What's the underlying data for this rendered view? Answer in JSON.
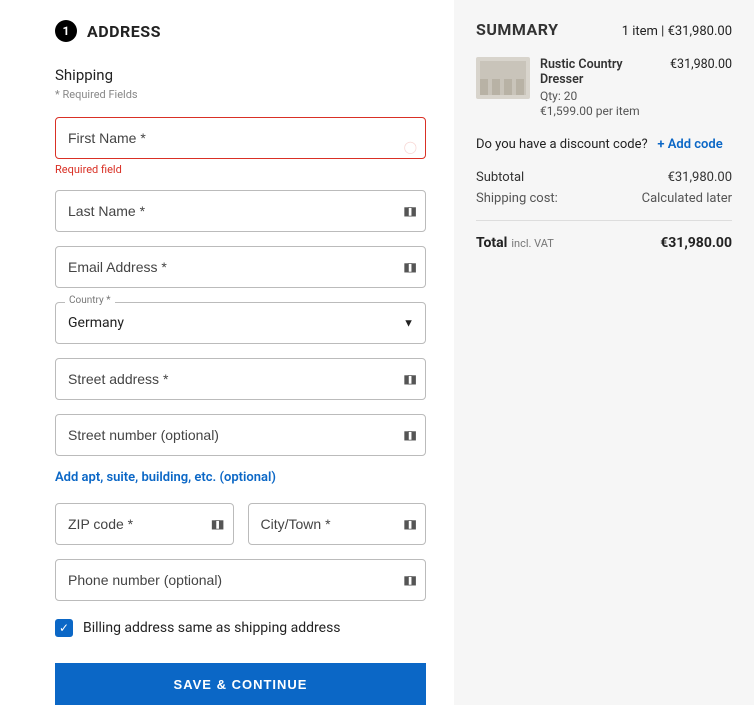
{
  "step": {
    "number": "1",
    "title": "ADDRESS"
  },
  "shipping": {
    "heading": "Shipping",
    "required_note": "* Required Fields",
    "first_name": {
      "placeholder": "First Name *",
      "error": "Required field"
    },
    "last_name": {
      "placeholder": "Last Name *"
    },
    "email": {
      "placeholder": "Email Address *"
    },
    "country": {
      "legend": "Country *",
      "value": "Germany"
    },
    "street": {
      "placeholder": "Street address *"
    },
    "street_no": {
      "placeholder": "Street number (optional)"
    },
    "apt_link": "Add apt, suite, building, etc. (optional)",
    "zip": {
      "placeholder": "ZIP code *"
    },
    "city": {
      "placeholder": "City/Town *"
    },
    "phone": {
      "placeholder": "Phone number (optional)"
    },
    "billing_same": "Billing address same as shipping address",
    "submit": "SAVE & CONTINUE"
  },
  "summary": {
    "title": "SUMMARY",
    "count_line": "1 item | €31,980.00",
    "item": {
      "name": "Rustic Country Dresser",
      "qty": "Qty: 20",
      "unit": "€1,599.00 per item",
      "price": "€31,980.00"
    },
    "discount_q": "Do you have a discount code?",
    "discount_link": "+ Add code",
    "subtotal_label": "Subtotal",
    "subtotal_value": "€31,980.00",
    "shipcost_label": "Shipping cost:",
    "shipcost_value": "Calculated later",
    "total_label": "Total",
    "vat_label": "incl. VAT",
    "total_value": "€31,980.00"
  }
}
